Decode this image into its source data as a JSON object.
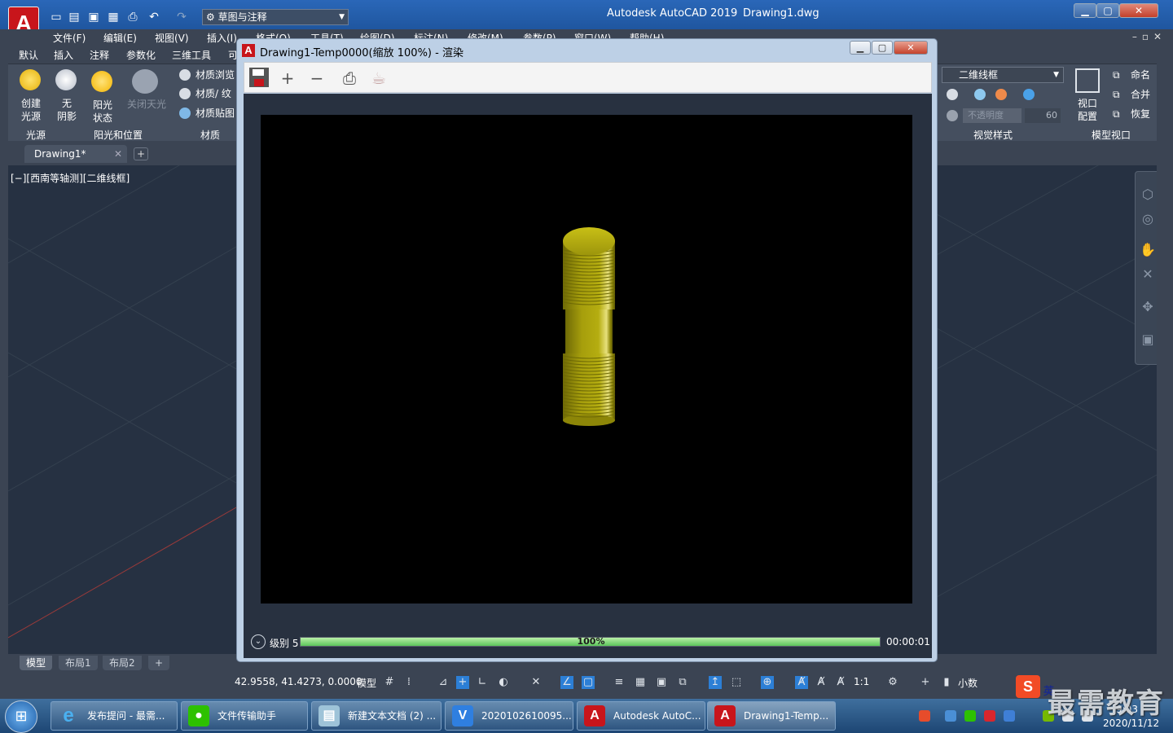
{
  "app": {
    "logo": "A",
    "title": "Autodesk AutoCAD 2019",
    "document": "Drawing1.dwg",
    "workspace": "草图与注释"
  },
  "menu": [
    "文件(F)",
    "编辑(E)",
    "视图(V)",
    "插入(I)",
    "格式(O)",
    "工具(T)",
    "绘图(D)",
    "标注(N)",
    "修改(M)",
    "参数(P)",
    "窗口(W)",
    "帮助(H)"
  ],
  "ribbon": {
    "tabs": [
      "默认",
      "插入",
      "注释",
      "参数化",
      "三维工具",
      "可"
    ],
    "lights": {
      "create_light": "创建\n光源",
      "no_shadow": "无\n阴影",
      "sun_status": "阳光\n状态",
      "sky_off": "关闭天光"
    },
    "materials": {
      "browser": "材质浏览",
      "mapping": "材质/ 纹",
      "texture": "材质贴图"
    },
    "panels": {
      "lights": "光源",
      "sun": "阳光和位置",
      "materials": "材质",
      "visual_styles": "视觉样式",
      "model_viewports": "模型视口"
    },
    "visual_style": "二维线框",
    "opacity_label": "不透明度",
    "opacity_value": "60",
    "viewport_config": "视口\n配置",
    "viewport_cmds": {
      "name": "命名",
      "join": "合并",
      "restore": "恢复"
    }
  },
  "doc_tab": "Drawing1*",
  "viewport_label": "[−][西南等轴测][二维线框]",
  "layout_tabs": [
    "模型",
    "布局1",
    "布局2"
  ],
  "status": {
    "coords": "42.9558, 41.4273, 0.0000",
    "model": "模型",
    "scale": "1:1",
    "units": "小数"
  },
  "render_window": {
    "logo": "A",
    "title": "Drawing1-Temp0000(缩放 100%) - 渲染",
    "level_label": "级别 5",
    "progress": 100,
    "progress_text": "100%",
    "elapsed": "00:00:01",
    "object_color": "#b5ad10"
  },
  "taskbar": {
    "items": [
      {
        "label": "发布提问 - 最需...",
        "icon": "e"
      },
      {
        "label": "文件传输助手",
        "icon": "wechat"
      },
      {
        "label": "新建文本文档 (2) ...",
        "icon": "notepad"
      },
      {
        "label": "2020102610095...",
        "icon": "v"
      },
      {
        "label": "Autodesk AutoC...",
        "icon": "A"
      },
      {
        "label": "Drawing1-Temp...",
        "icon": "A"
      }
    ],
    "time": "9:03",
    "date": "2020/11/12",
    "ime": "英",
    "ime_logo": "S"
  },
  "watermark": "最需教育",
  "colors": {
    "acad_red": "#c8151b",
    "titlebar": "#2a67b8",
    "progress": "#5cc55a"
  }
}
